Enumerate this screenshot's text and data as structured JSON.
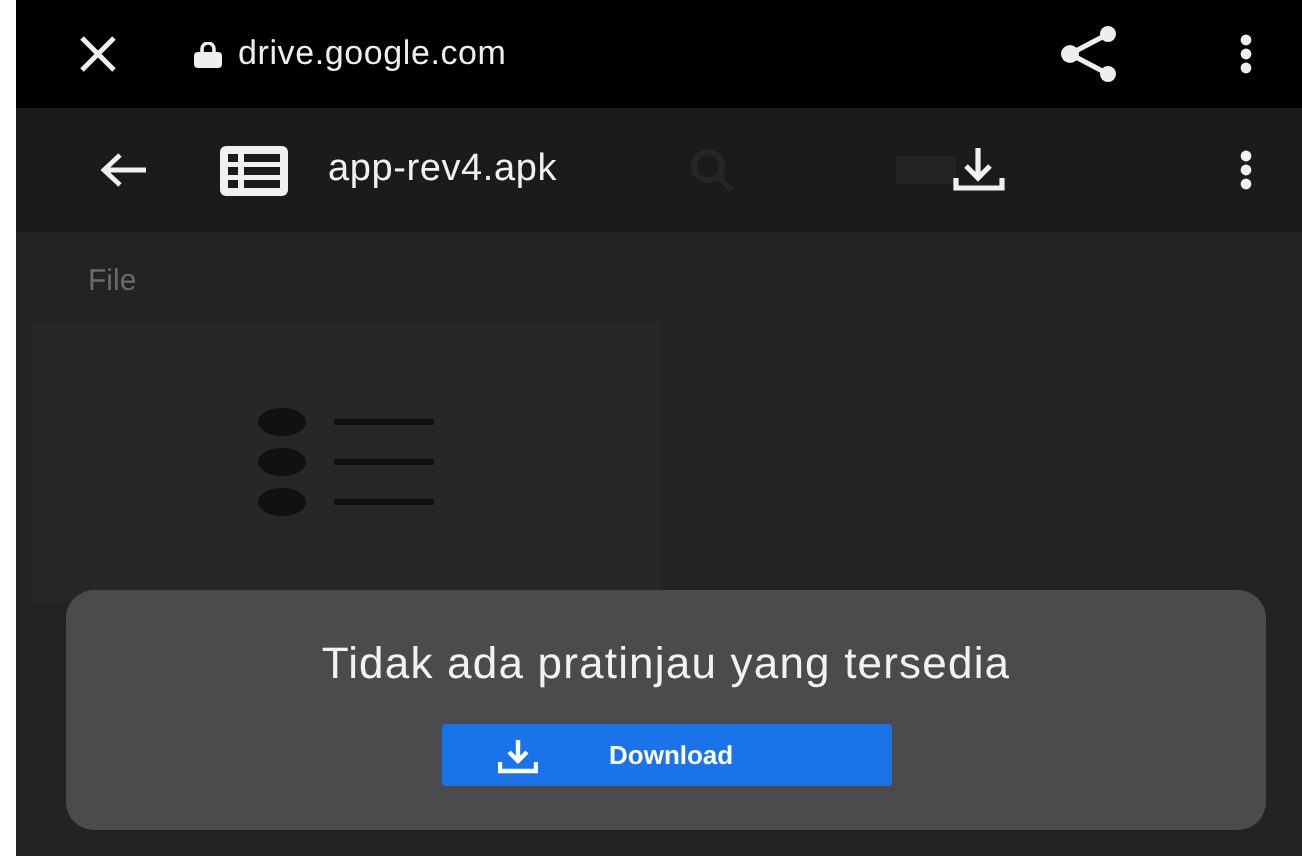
{
  "address_bar": {
    "url": "drive.google.com"
  },
  "toolbar": {
    "title": "app-rev4.apk"
  },
  "section": {
    "label": "File"
  },
  "dialog": {
    "message": "Tidak ada pratinjau yang tersedia",
    "button": "Download"
  }
}
